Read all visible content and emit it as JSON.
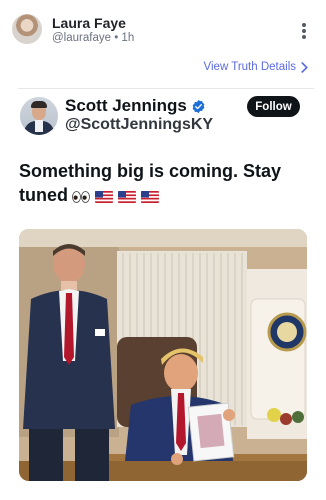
{
  "header": {
    "author_name": "Laura Faye",
    "author_handle": "@laurafaye",
    "separator": "•",
    "time_ago": "1h",
    "more_menu_icon": "more-vertical-icon"
  },
  "truth_details": {
    "label": "View Truth Details",
    "icon": "chevron-right-icon",
    "color": "#5b6be0"
  },
  "embedded_post": {
    "name": "Scott Jennings",
    "verified_icon": "verified-badge-icon",
    "verified_color": "#1d9bf0",
    "handle": "@ScottJenningsKY",
    "follow_label": "Follow",
    "text": "Something big is coming. Stay tuned",
    "emojis": [
      "eyes-icon",
      "us-flag-icon",
      "us-flag-icon",
      "us-flag-icon"
    ],
    "photo_description_icon": "post-photo"
  }
}
